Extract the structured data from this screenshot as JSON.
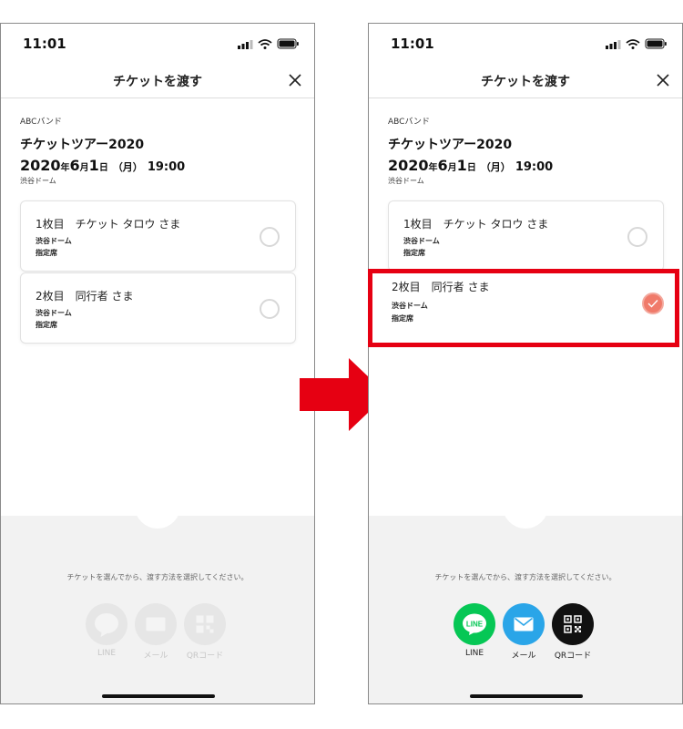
{
  "status": {
    "time": "11:01"
  },
  "nav": {
    "title": "チケットを渡す"
  },
  "event": {
    "artist": "ABCバンド",
    "title": "チケットツアー2020",
    "year": "2020",
    "year_unit": "年",
    "month": "6",
    "month_unit": "月",
    "day": "1",
    "day_unit": "日",
    "weekday": "（月）",
    "time": "19:00",
    "venue": "渋谷ドーム"
  },
  "tickets": [
    {
      "name": "1枚目　チケット タロウ さま",
      "venue": "渋谷ドーム",
      "seat": "指定席"
    },
    {
      "name": "2枚目　同行者 さま",
      "venue": "渋谷ドーム",
      "seat": "指定席"
    }
  ],
  "bottom": {
    "instruction": "チケットを選んでから、渡す方法を選択してください。",
    "share_options": [
      {
        "label": "LINE",
        "icon": "line-icon",
        "color": "#06c755"
      },
      {
        "label": "メール",
        "icon": "mail-icon",
        "color": "#2aa5e8"
      },
      {
        "label": "QRコード",
        "icon": "qr-code-icon",
        "color": "#111111"
      }
    ]
  },
  "annotation": {
    "highlight_color": "#e60012",
    "arrow_color": "#e60012"
  },
  "selection": {
    "left_selected": [],
    "right_selected": [
      1
    ]
  }
}
